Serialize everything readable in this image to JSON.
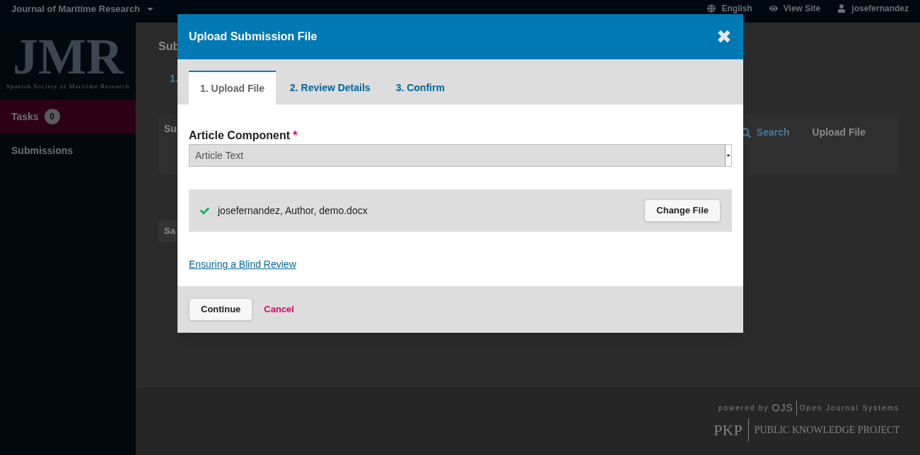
{
  "top_bar": {
    "site_name": "Journal of Maritime Research",
    "links": [
      {
        "kind": "language",
        "label": "English"
      },
      {
        "kind": "view",
        "label": "View Site"
      },
      {
        "kind": "user",
        "label": "josefernandez"
      }
    ]
  },
  "sidebar": {
    "logo": {
      "letters": "JMR",
      "tagline": "Spanish Society of Maritime Research"
    },
    "items": [
      {
        "label": "Tasks",
        "count": "0",
        "selected": true
      },
      {
        "label": "Submissions",
        "selected": false
      }
    ]
  },
  "page": {
    "heading": "Sub",
    "tab": "1.",
    "card_title": "Su",
    "search": "Search",
    "upload": "Upload File",
    "button": "Sa"
  },
  "footer": {
    "powered_by": "powered by",
    "ojs": "OJS",
    "ojs_name": "Open Journal Systems",
    "pkp": "PKP",
    "pkp_name": "PUBLIC KNOWLEDGE PROJECT"
  },
  "modal": {
    "title": "Upload Submission File",
    "close": "✖",
    "steps": [
      {
        "label": "1. Upload File",
        "selected": true
      },
      {
        "label": "2. Review Details",
        "selected": false
      },
      {
        "label": "3. Confirm",
        "selected": false
      }
    ],
    "field": {
      "label": "Article Component",
      "required_mark": "*",
      "value": "Article Text"
    },
    "file": {
      "uploaded": true,
      "name": "josefernandez, Author, demo.docx",
      "button": "Change File"
    },
    "link": "Ensuring a Blind Review",
    "buttons": {
      "primary": "Continue",
      "cancel": "Cancel"
    }
  }
}
